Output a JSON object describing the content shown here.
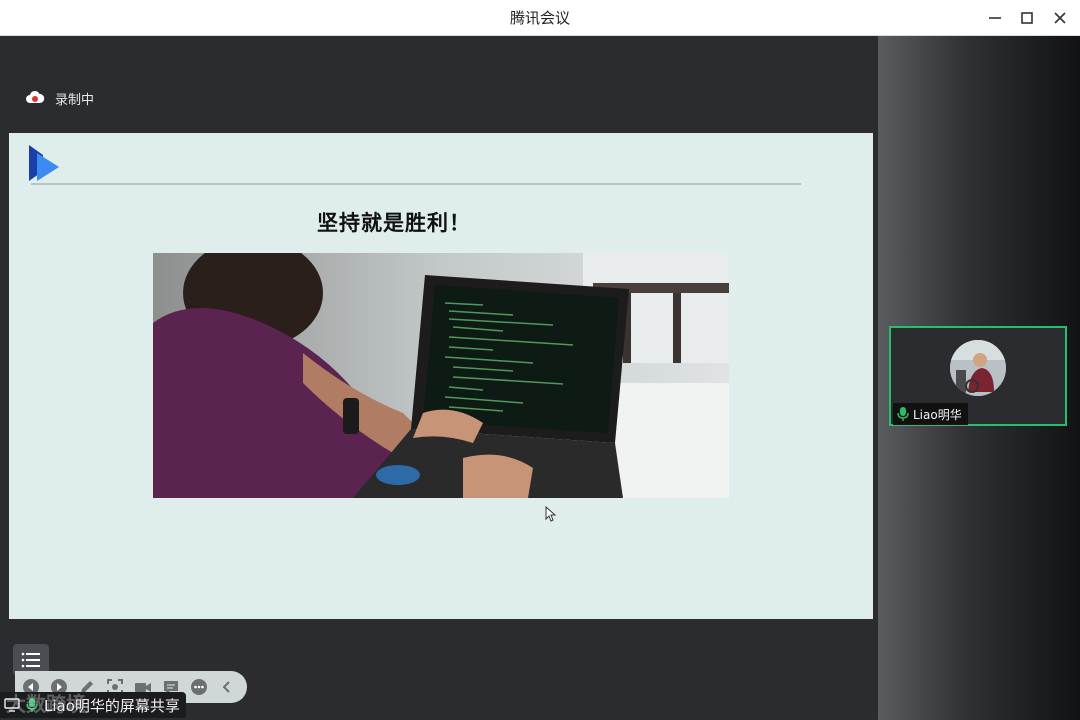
{
  "window": {
    "title": "腾讯会议",
    "controls": [
      "minimize-icon",
      "maximize-icon",
      "close-icon"
    ]
  },
  "recording": {
    "label": "录制中",
    "icon": "cloud-record-icon",
    "color": "#e03030"
  },
  "slide": {
    "title": "坚持就是胜利！",
    "logo": "play-logo-icon",
    "accent": "#1e6fe0"
  },
  "slide_toolbar": {
    "menu_icon": "list-icon",
    "buttons": [
      "prev-icon",
      "next-icon",
      "pen-icon",
      "screenshot-icon",
      "camera-icon",
      "comment-icon",
      "more-icon",
      "collapse-icon"
    ]
  },
  "participant": {
    "name": "Liao明华",
    "mic_icon": "microphone-icon",
    "mic_color": "#2bbd6b",
    "border_color": "#2bbd6b"
  },
  "share_label": {
    "text": "Liao明华的屏幕共享",
    "icon": "screen-share-icon"
  },
  "watermark": {
    "text": "大数跨境"
  }
}
